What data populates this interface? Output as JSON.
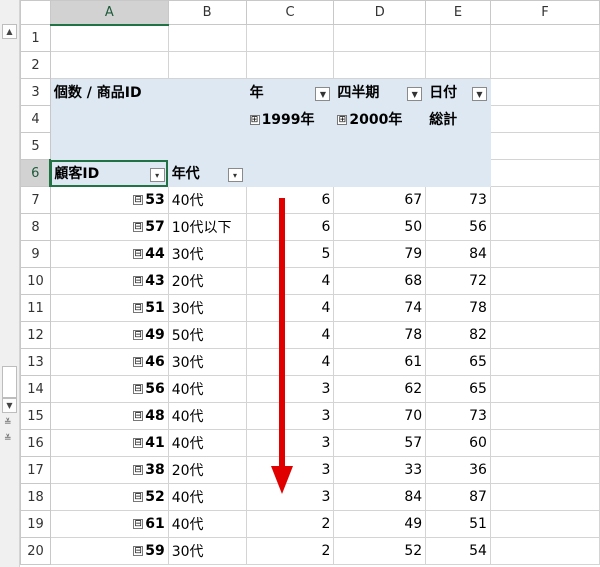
{
  "column_headers": [
    "A",
    "B",
    "C",
    "D",
    "E",
    "F"
  ],
  "scroll_icons": {
    "up": "▲",
    "down": "▼",
    "top": "≚",
    "bottom": "≚"
  },
  "pivot": {
    "label": "個数 / 商品ID",
    "year_field": "年",
    "quarter_field": "四半期",
    "date_field": "日付",
    "year_1999": "1999年",
    "year_2000": "2000年",
    "grand_total": "総計",
    "row_field_customer": "顧客ID",
    "row_field_age": "年代",
    "expand_glyph": "⊞",
    "collapse_glyph": "⊟"
  },
  "rows": [
    {
      "num": "1"
    },
    {
      "num": "2"
    },
    {
      "num": "3"
    },
    {
      "num": "4"
    },
    {
      "num": "5"
    },
    {
      "num": "6"
    },
    {
      "num": "7",
      "id": "53",
      "age": "40代",
      "c": "6",
      "d": "67",
      "e": "73"
    },
    {
      "num": "8",
      "id": "57",
      "age": "10代以下",
      "c": "6",
      "d": "50",
      "e": "56"
    },
    {
      "num": "9",
      "id": "44",
      "age": "30代",
      "c": "5",
      "d": "79",
      "e": "84"
    },
    {
      "num": "10",
      "id": "43",
      "age": "20代",
      "c": "4",
      "d": "68",
      "e": "72"
    },
    {
      "num": "11",
      "id": "51",
      "age": "30代",
      "c": "4",
      "d": "74",
      "e": "78"
    },
    {
      "num": "12",
      "id": "49",
      "age": "50代",
      "c": "4",
      "d": "78",
      "e": "82"
    },
    {
      "num": "13",
      "id": "46",
      "age": "30代",
      "c": "4",
      "d": "61",
      "e": "65"
    },
    {
      "num": "14",
      "id": "56",
      "age": "40代",
      "c": "3",
      "d": "62",
      "e": "65"
    },
    {
      "num": "15",
      "id": "48",
      "age": "40代",
      "c": "3",
      "d": "70",
      "e": "73"
    },
    {
      "num": "16",
      "id": "41",
      "age": "40代",
      "c": "3",
      "d": "57",
      "e": "60"
    },
    {
      "num": "17",
      "id": "38",
      "age": "20代",
      "c": "3",
      "d": "33",
      "e": "36"
    },
    {
      "num": "18",
      "id": "52",
      "age": "40代",
      "c": "3",
      "d": "84",
      "e": "87"
    },
    {
      "num": "19",
      "id": "61",
      "age": "40代",
      "c": "2",
      "d": "49",
      "e": "51"
    },
    {
      "num": "20",
      "id": "59",
      "age": "30代",
      "c": "2",
      "d": "52",
      "e": "54"
    }
  ],
  "colors": {
    "pivot_header_bg": "#dde8f3",
    "selection_green": "#217346",
    "arrow_red": "#e00000"
  },
  "annotation": {
    "icon": "down-arrow-icon"
  }
}
